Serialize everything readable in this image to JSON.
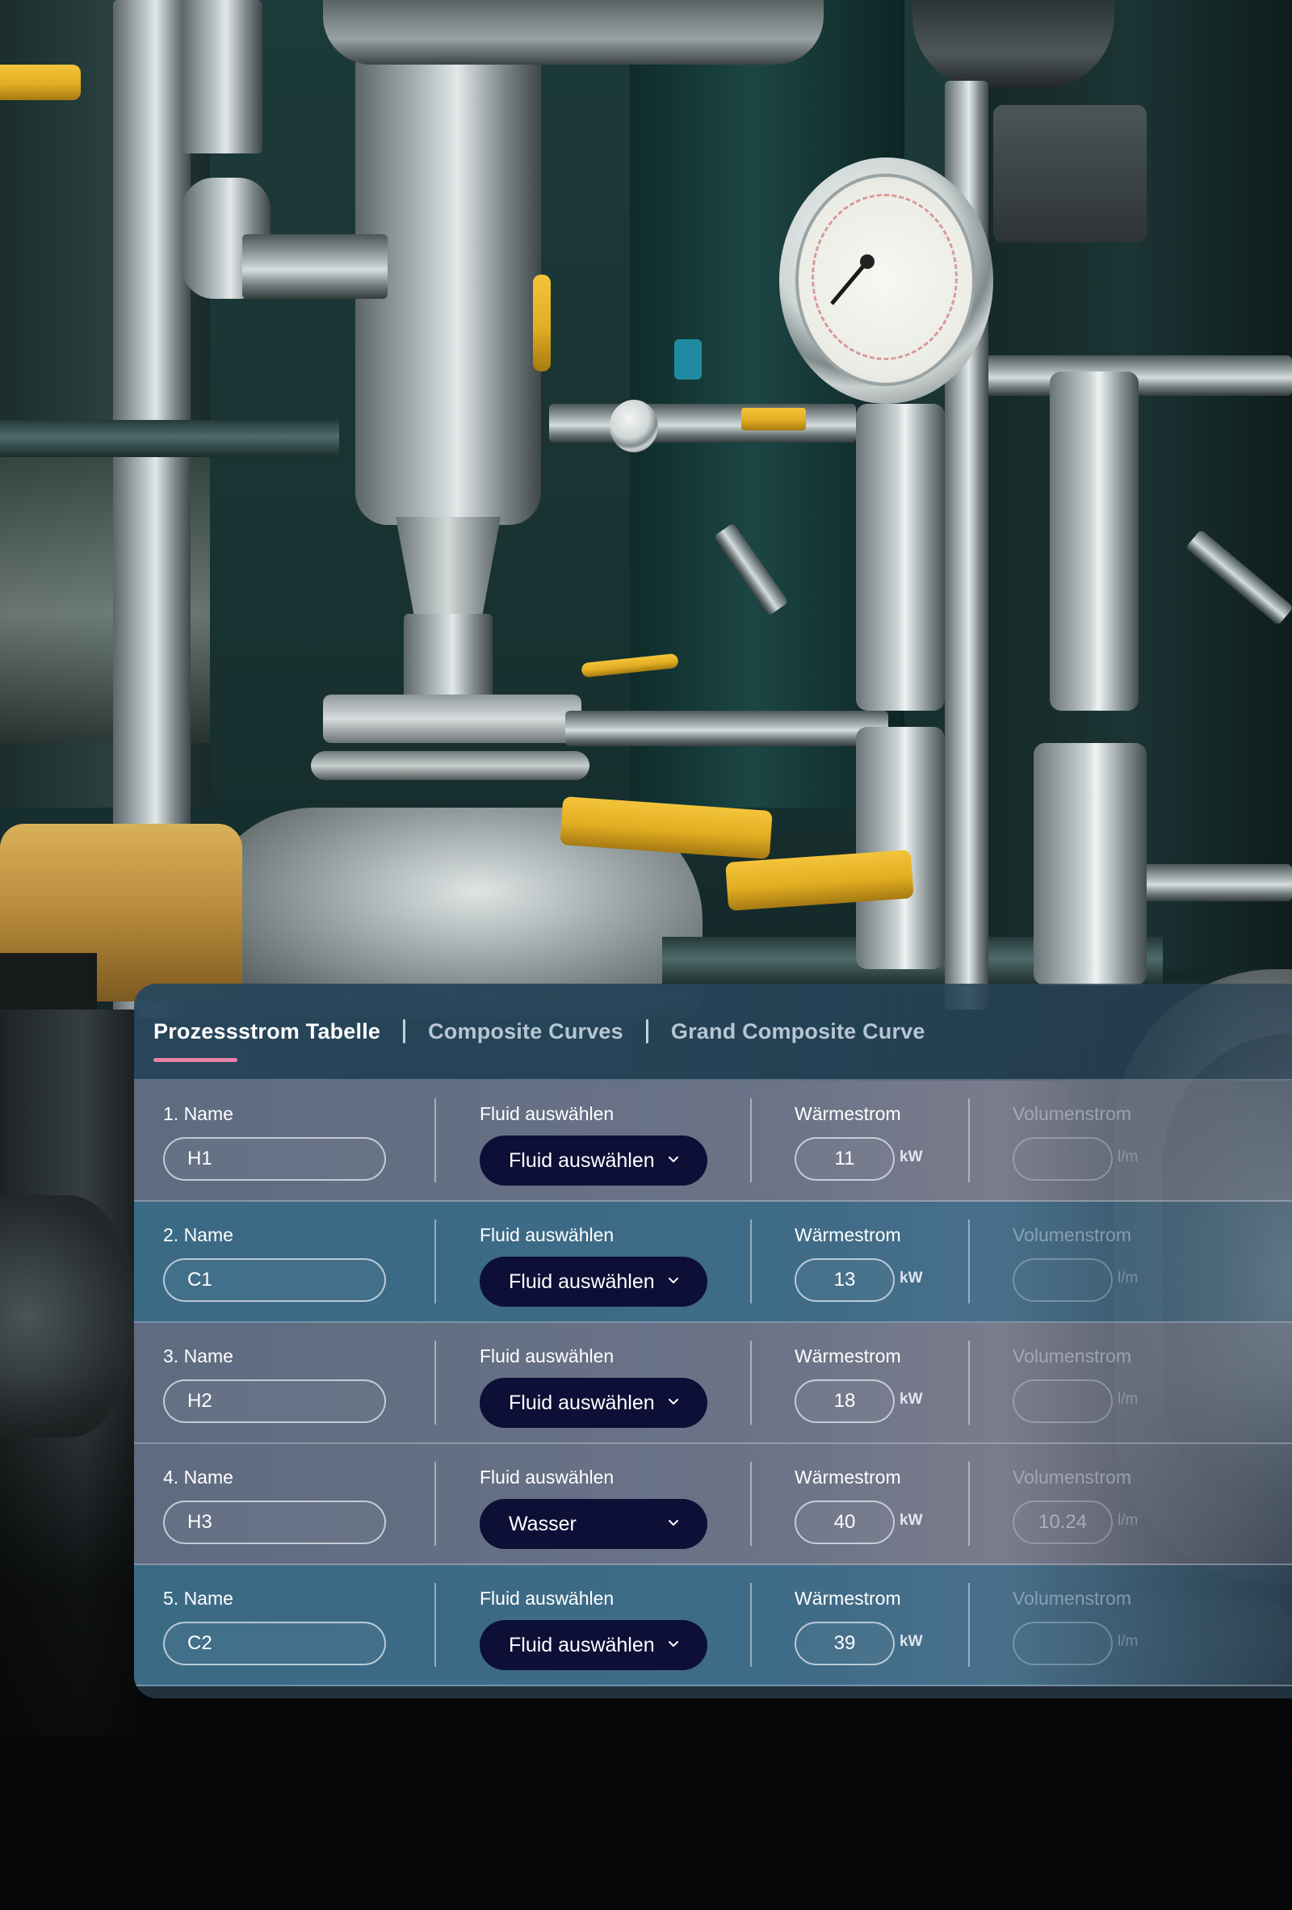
{
  "tabs": [
    {
      "label": "Prozessstrom Tabelle",
      "active": true
    },
    {
      "label": "Composite Curves",
      "active": false
    },
    {
      "label": "Grand Composite Curve",
      "active": false
    }
  ],
  "columns": {
    "fluid_label": "Fluid auswählen",
    "waermestrom_label": "Wärmestrom",
    "volumenstrom_label": "Volumenstrom",
    "waermestrom_unit": "kW",
    "volumenstrom_unit": "l/m"
  },
  "rows": [
    {
      "name_label": "1. Name",
      "name_value": "H1",
      "fluid": "Fluid auswählen",
      "waermestrom": "11",
      "volumenstrom": ""
    },
    {
      "name_label": "2. Name",
      "name_value": "C1",
      "fluid": "Fluid auswählen",
      "waermestrom": "13",
      "volumenstrom": ""
    },
    {
      "name_label": "3. Name",
      "name_value": "H2",
      "fluid": "Fluid auswählen",
      "waermestrom": "18",
      "volumenstrom": ""
    },
    {
      "name_label": "4. Name",
      "name_value": "H3",
      "fluid": "Wasser",
      "waermestrom": "40",
      "volumenstrom": "10.24"
    },
    {
      "name_label": "5. Name",
      "name_value": "C2",
      "fluid": "Fluid auswählen",
      "waermestrom": "39",
      "volumenstrom": ""
    }
  ],
  "colors": {
    "accent_underline": "#e782a7",
    "dropdown_bg": "#0d0f36",
    "row_odd": "#6b7387",
    "row_even": "#3e6b87"
  },
  "icons": {
    "dropdown": "chevron-down-icon"
  }
}
